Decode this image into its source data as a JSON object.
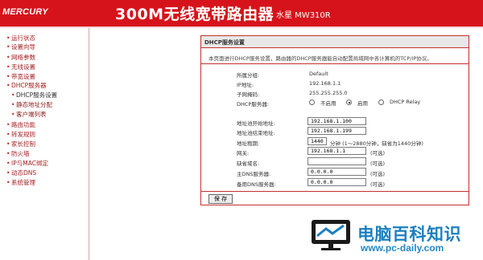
{
  "header": {
    "logo": "MERCURY",
    "title": "300M无线宽带路由器",
    "model": "水星 MW310R",
    "colors": {
      "header_bg": "#d6131b",
      "panel_border": "#c43030"
    }
  },
  "sidebar": {
    "items": [
      {
        "label": "运行状态"
      },
      {
        "label": "设置向导"
      },
      {
        "label": "网络参数"
      },
      {
        "label": "无线设置"
      },
      {
        "label": "带宽设置"
      },
      {
        "label": "DHCP服务器"
      },
      {
        "label": "DHCP服务设置"
      },
      {
        "label": "静态地址分配"
      },
      {
        "label": "客户端列表"
      },
      {
        "label": "路由功能"
      },
      {
        "label": "转发规则"
      },
      {
        "label": "家长控制"
      },
      {
        "label": "防火墙"
      },
      {
        "label": "IP与MAC绑定"
      },
      {
        "label": "动态DNS"
      },
      {
        "label": "系统管理"
      }
    ]
  },
  "panel": {
    "title": "DHCP服务设置",
    "description": "本页面进行DHCP服务设置，路由器的DHCP服务器能自动配置局域网中各计算机的TCP/IP协议。",
    "labels": {
      "group": "所属分组:",
      "ip": "IP地址:",
      "mask": "子网掩码:",
      "dhcp": "DHCP服务器:",
      "start": "地址池开始地址:",
      "end": "地址池结束地址:",
      "lease": "地址租期:",
      "gateway": "网关:",
      "domain": "缺省域名:",
      "dns1": "主DNS服务器:",
      "dns2": "备用DNS服务器:"
    },
    "values": {
      "group": "Default",
      "ip": "192.168.1.1",
      "mask": "255.255.255.0"
    },
    "dhcp_options": [
      "不启用",
      "启用",
      "DHCP Relay"
    ],
    "dhcp_selected": "启用",
    "fields": {
      "start": "192.168.1.100",
      "end": "192.168.1.199",
      "lease": "1440",
      "gateway": "192.168.1.1",
      "domain": "",
      "dns1": "0.0.0.0",
      "dns2": "0.0.0.0"
    },
    "lease_note": "分钟 (1～2880分钟，缺省为1440分钟)",
    "optional_note": "(可选)",
    "save_label": "保 存"
  },
  "watermark": {
    "text": "电脑百科知识",
    "url": "www.pc-daily.com"
  }
}
